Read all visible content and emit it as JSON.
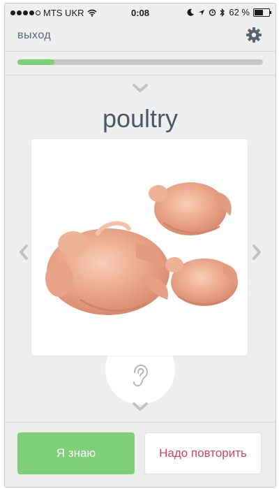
{
  "status_bar": {
    "carrier": "MTS UKR",
    "time": "0:08",
    "battery_percent": "62 %",
    "battery_level": 0.62,
    "signal_bars": 4
  },
  "header": {
    "exit_label": "выход",
    "settings_icon": "gear-icon"
  },
  "progress": {
    "fraction": 0.15
  },
  "card": {
    "word": "poultry",
    "image_subject": "raw whole chickens"
  },
  "actions": {
    "know_label": "Я знаю",
    "repeat_label": "Надо повторить"
  },
  "colors": {
    "accent_green": "#7fcf78",
    "repeat_red": "#d24466",
    "word_text": "#4d5866",
    "background": "#efefef"
  }
}
